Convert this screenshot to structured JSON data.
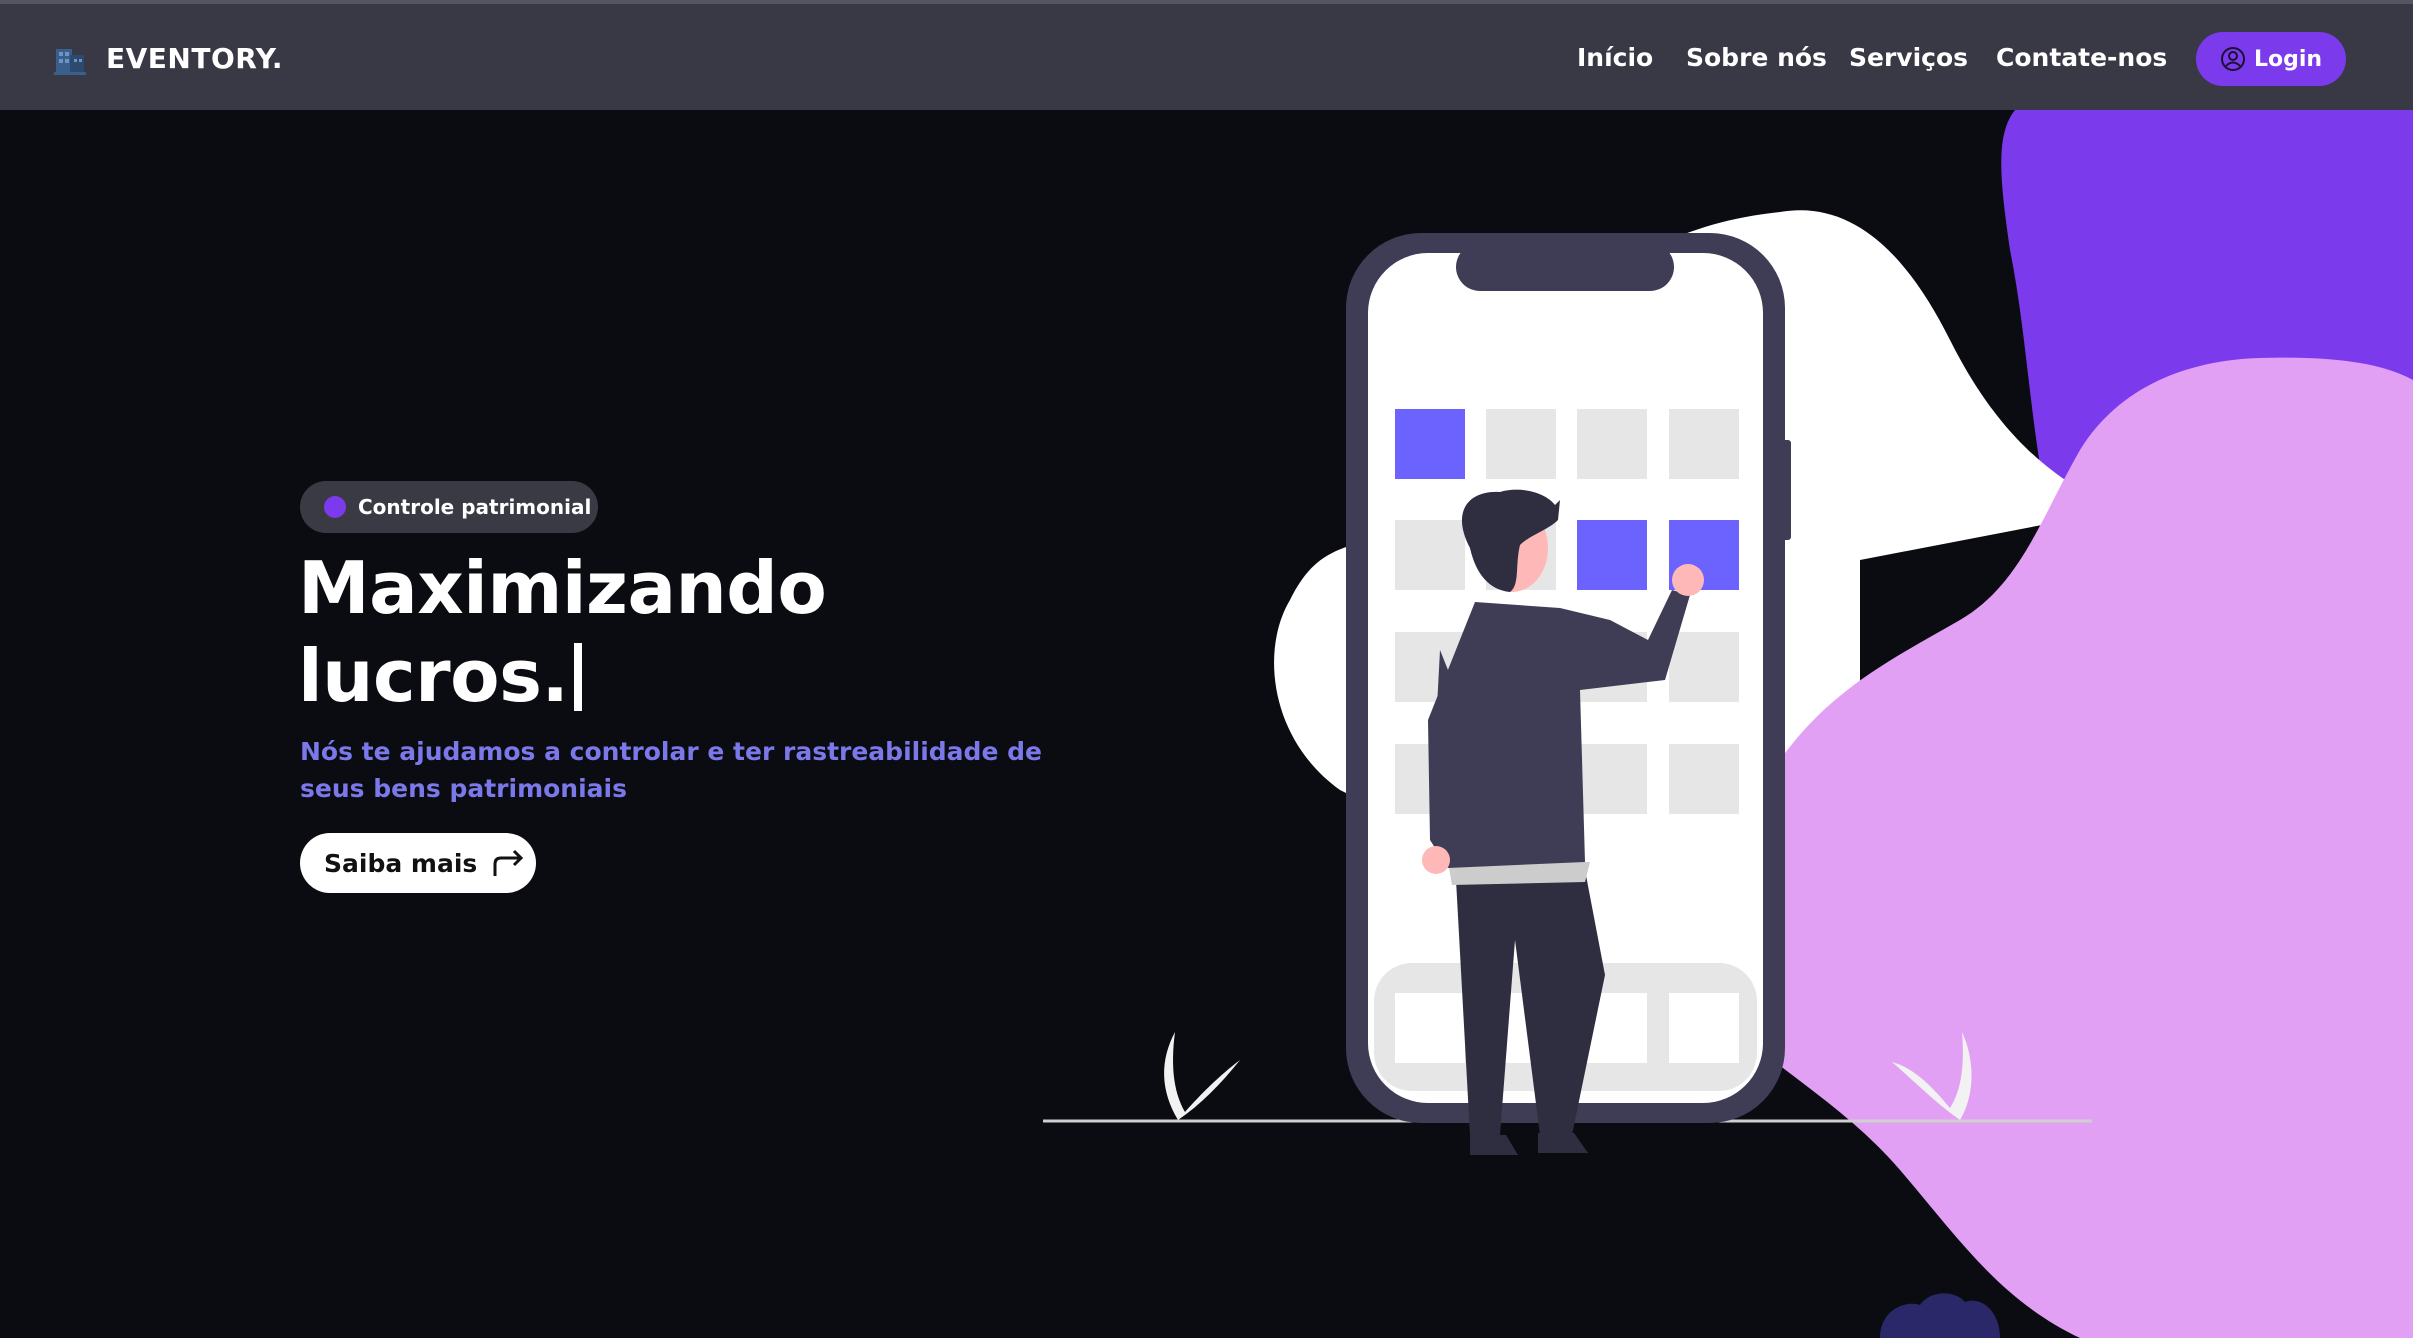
{
  "header": {
    "brand": "EVENTORY.",
    "brand_icon": "building-icon",
    "nav": [
      {
        "label": "Início"
      },
      {
        "label": "Sobre nós"
      },
      {
        "label": "Serviços"
      },
      {
        "label": "Contate-nos"
      }
    ],
    "login_label": "Login",
    "login_icon": "user-circle-icon"
  },
  "hero": {
    "badge": "Controle patrimonial",
    "title_line1": "Maximizando",
    "title_line2": "lucros.",
    "subtitle": "Nós te ajudamos a controlar e ter rastreabilidade de seus bens patrimoniais",
    "cta_label": "Saiba mais",
    "cta_icon": "arrow-forward-icon"
  },
  "colors": {
    "accent": "#7c3aed",
    "subtitle": "#7b78ea",
    "blob_pink": "#e2a0f4",
    "blob_purple": "#7c3aed",
    "tile_active": "#6c63ff"
  }
}
